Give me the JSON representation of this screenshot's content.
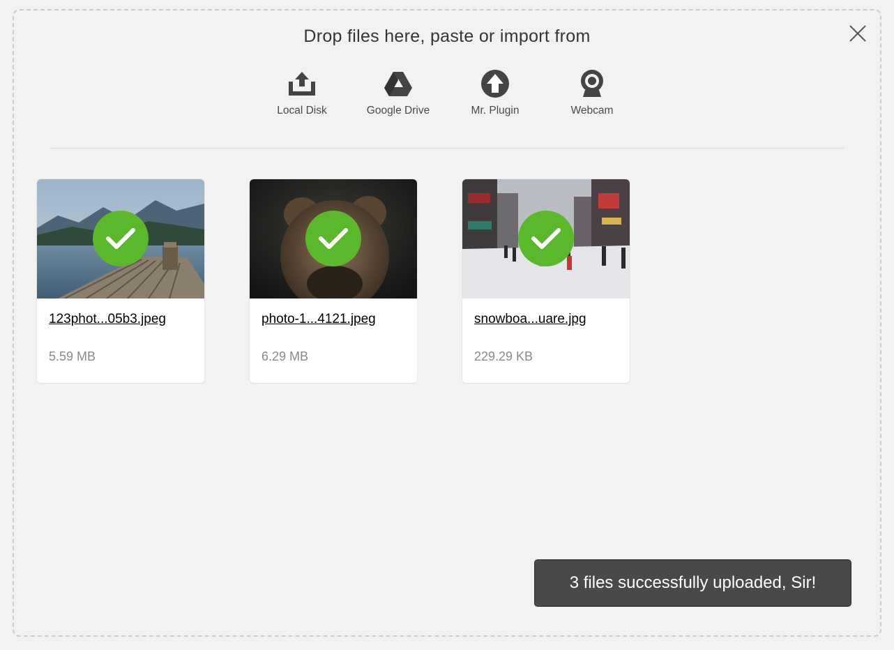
{
  "header": {
    "title": "Drop files here, paste or import from"
  },
  "sources": [
    {
      "label": "Local Disk",
      "icon": "local-disk-icon"
    },
    {
      "label": "Google Drive",
      "icon": "google-drive-icon"
    },
    {
      "label": "Mr. Plugin",
      "icon": "upload-arrow-icon"
    },
    {
      "label": "Webcam",
      "icon": "webcam-icon"
    }
  ],
  "files": [
    {
      "name": "123phot...05b3.jpeg",
      "size": "5.59 MB",
      "status": "uploaded"
    },
    {
      "name": "photo-1...4121.jpeg",
      "size": "6.29 MB",
      "status": "uploaded"
    },
    {
      "name": "snowboa...uare.jpg",
      "size": "229.29 KB",
      "status": "uploaded"
    }
  ],
  "toast": {
    "message": "3 files successfully uploaded, Sir!"
  },
  "colors": {
    "success": "#5cb82b",
    "toast_bg": "#494949",
    "background": "#f2f2f2"
  }
}
